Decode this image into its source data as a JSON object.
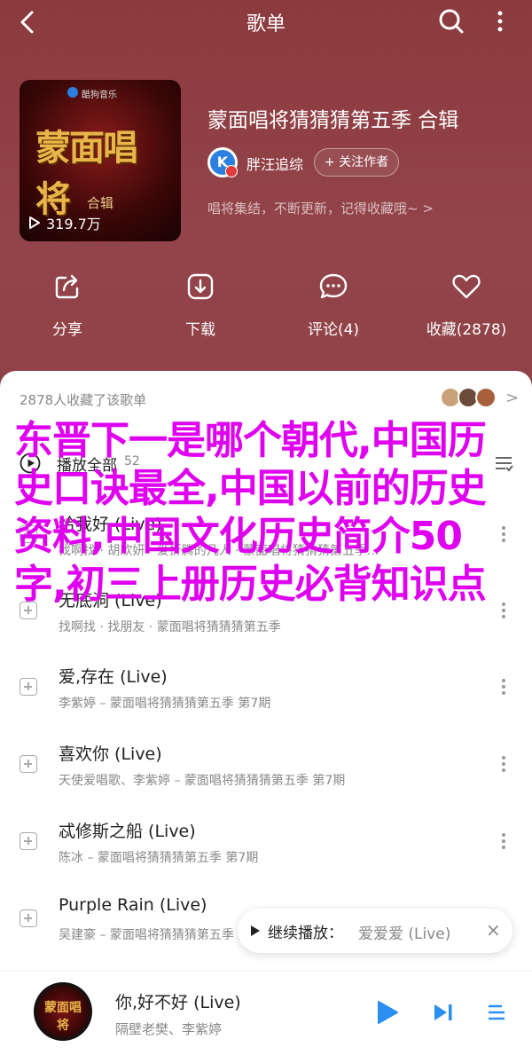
{
  "header": {
    "title": "歌单"
  },
  "cover": {
    "brand": "酷狗音乐",
    "art_text": "蒙面唱将",
    "subtitle": "合辑",
    "plays": "319.7万"
  },
  "playlist": {
    "name": "蒙面唱将猜猜猜第五季 合辑",
    "creator": "胖汪追综",
    "follow_label": "+ 关注作者",
    "description": "唱将集结，不断更新，记得收藏哦~ >"
  },
  "actions": [
    {
      "label": "分享",
      "icon": "share-icon"
    },
    {
      "label": "下载",
      "icon": "download-icon"
    },
    {
      "label": "评论(4)",
      "icon": "comment-icon"
    },
    {
      "label": "收藏(2878)",
      "icon": "heart-icon"
    }
  ],
  "collected": {
    "text": "2878人收藏了该歌单",
    "chevron": ">"
  },
  "list_header": {
    "play_all": "播放全部",
    "count": "52"
  },
  "songs": [
    {
      "name": "给我好 (Live)",
      "meta": "找啊找 · 胡欣妍 · 爱折腾的凡人 · 蒙面唱将猜猜猜第五季..."
    },
    {
      "name": "无底洞 (Live)",
      "meta": "找啊找 · 找朋友 · 蒙面唱将猜猜猜第五季"
    },
    {
      "name": "爱,存在 (Live)",
      "meta": "李紫婷 – 蒙面唱将猜猜猜第五季 第7期"
    },
    {
      "name": "喜欢你 (Live)",
      "meta": "天使爱唱歌、李紫婷 – 蒙面唱将猜猜猜第五季 第7期"
    },
    {
      "name": "忒修斯之船 (Live)",
      "meta": "陈冰 – 蒙面唱将猜猜猜第五季 第7期"
    },
    {
      "name": "Purple Rain (Live)",
      "meta": "吴建豪 – 蒙面唱将猜猜猜第五季 第7期"
    }
  ],
  "overlay_title": "东晋下一是哪个朝代,中国历史口诀最全,中国以前的历史资料,中国文化历史简介50字,初三上册历史必背知识点",
  "toast": {
    "label": "继续播放：",
    "song": "爱爱爱 (Live)",
    "close": "×"
  },
  "player": {
    "title": "你,好不好 (Live)",
    "artist": "隔壁老樊、李紫婷",
    "disc_text": "蒙面唱将"
  },
  "colors": {
    "header_bg": "#8b3a3d",
    "overlay_text": "#e000f0",
    "accent_blue": "#2a8ff0"
  }
}
